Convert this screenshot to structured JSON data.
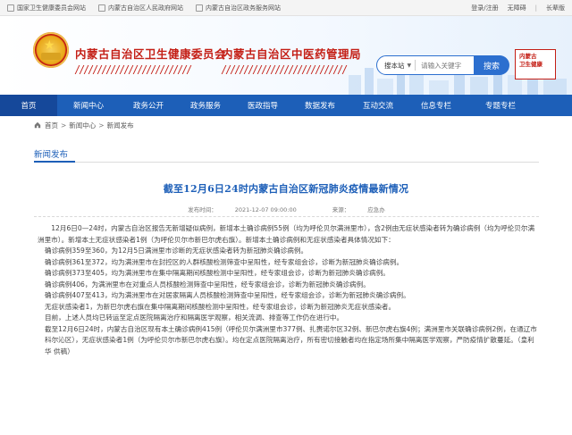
{
  "topbar": {
    "links": [
      "国家卫生健康委员会网站",
      "内蒙古自治区人民政府网站",
      "内蒙古自治区政务服务网站"
    ],
    "register": "登录/注册",
    "accessible": "无障碍",
    "old_version": "长辈版"
  },
  "header": {
    "title_health": "内蒙古自治区卫生健康委员会",
    "title_tcm": "内蒙古自治区中医药管理局",
    "search_scope": "搜本站",
    "search_placeholder": "请输入关键字",
    "search_button": "搜索",
    "seal_text": "内蒙古卫生健康"
  },
  "nav": {
    "items": [
      "首页",
      "新闻中心",
      "政务公开",
      "政务服务",
      "医政指导",
      "数据发布",
      "互动交流",
      "信息专栏",
      "专题专栏"
    ]
  },
  "breadcrumb": [
    "首页",
    "新闻中心",
    "新闻发布"
  ],
  "section": {
    "title": "新闻发布"
  },
  "article": {
    "title": "截至12月6日24时内蒙古自治区新冠肺炎疫情最新情况",
    "date_label": "发布时间：",
    "date": "2021-12-07 09:00:00",
    "source_label": "来源：",
    "source": "应急办",
    "paragraphs": [
      "12月6日0—24时，内蒙古自治区报告无新增疑似病例，新增本土确诊病例55例（均为呼伦贝尔满洲里市），含2例由无症状感染者转为确诊病例（均为呼伦贝尔满洲里市）。新增本土无症状感染者1例（为呼伦贝尔市新巴尔虎右旗）。新增本土确诊病例和无症状感染者具体情况如下：",
      "确诊病例359至360，为12月5日满洲里市诊断的无症状感染者转为新冠肺炎确诊病例。",
      "确诊病例361至372，均为满洲里市在封控区的人群核酸检测筛查中呈阳性，经专家组会诊，诊断为新冠肺炎确诊病例。",
      "确诊病例373至405，均为满洲里市在集中隔离期间核酸检测中呈阳性，经专家组会诊，诊断为新冠肺炎确诊病例。",
      "确诊病例406，为满洲里市在对重点人员核酸检测筛查中呈阳性，经专家组会诊，诊断为新冠肺炎确诊病例。",
      "确诊病例407至413，均为满洲里市在对居家隔离人员核酸检测筛查中呈阳性，经专家组会诊，诊断为新冠肺炎确诊病例。",
      "无症状感染者1，为新巴尔虎右旗在集中隔离期间核酸检测中呈阳性，经专家组会诊，诊断为新冠肺炎无症状感染者。",
      "目前，上述人员均已转运至定点医院隔离治疗和隔离医学观察，相关流调、排查等工作仍在进行中。",
      "截至12月6日24时，内蒙古自治区现有本土确诊病例415例（呼伦贝尔满洲里市377例、扎赉诺尔区32例、新巴尔虎右旗4例；满洲里市关联确诊病例2例，在通辽市科尔沁区），无症状感染者1例（为呼伦贝尔市新巴尔虎右旗）。均在定点医院隔离治疗，所有密切接触者均在指定场所集中隔离医学观察，严防疫情扩散蔓延。（皇利华 供稿）"
    ]
  },
  "colors": {
    "brand_blue": "#1d5fb8",
    "brand_red": "#c41f16"
  }
}
